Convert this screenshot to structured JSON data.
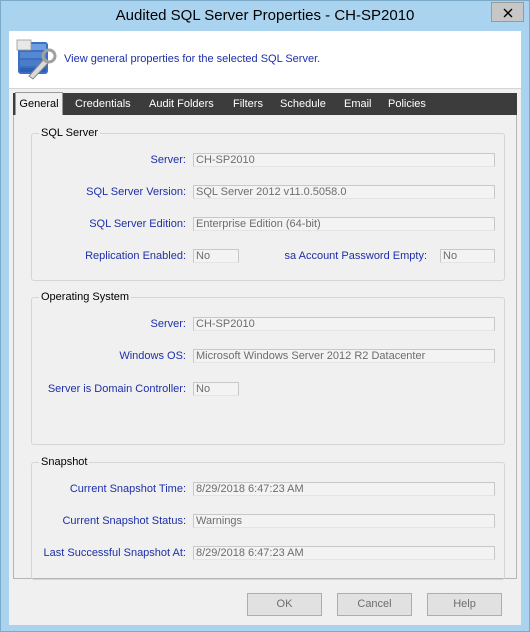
{
  "window": {
    "title": "Audited SQL Server Properties - CH-SP2010"
  },
  "header": {
    "icon": "database-wrench-icon",
    "description": "View general properties for the selected SQL Server."
  },
  "tabs": [
    {
      "label": "General",
      "active": true
    },
    {
      "label": "Credentials",
      "active": false
    },
    {
      "label": "Audit Folders",
      "active": false
    },
    {
      "label": "Filters",
      "active": false
    },
    {
      "label": "Schedule",
      "active": false
    },
    {
      "label": "Email",
      "active": false
    },
    {
      "label": "Policies",
      "active": false
    }
  ],
  "sql_server": {
    "legend": "SQL Server",
    "server_label": "Server:",
    "server_value": "CH-SP2010",
    "version_label": "SQL Server Version:",
    "version_value": "SQL Server 2012 v11.0.5058.0",
    "edition_label": "SQL Server Edition:",
    "edition_value": "Enterprise Edition (64-bit)",
    "replication_label": "Replication Enabled:",
    "replication_value": "No",
    "sa_label": "sa Account Password Empty:",
    "sa_value": "No"
  },
  "operating_system": {
    "legend": "Operating System",
    "server_label": "Server:",
    "server_value": "CH-SP2010",
    "os_label": "Windows OS:",
    "os_value": "Microsoft Windows Server 2012 R2 Datacenter",
    "dc_label": "Server is Domain Controller:",
    "dc_value": "No"
  },
  "snapshot": {
    "legend": "Snapshot",
    "time_label": "Current Snapshot Time:",
    "time_value": "8/29/2018 6:47:23 AM",
    "status_label": "Current Snapshot Status:",
    "status_value": "Warnings",
    "last_label": "Last Successful Snapshot At:",
    "last_value": "8/29/2018 6:47:23 AM"
  },
  "buttons": {
    "ok": "OK",
    "cancel": "Cancel",
    "help": "Help"
  },
  "colors": {
    "title_bar": "#a9d3ee",
    "label_blue": "#1e2fa8",
    "tab_bar": "#3c3c3c"
  }
}
